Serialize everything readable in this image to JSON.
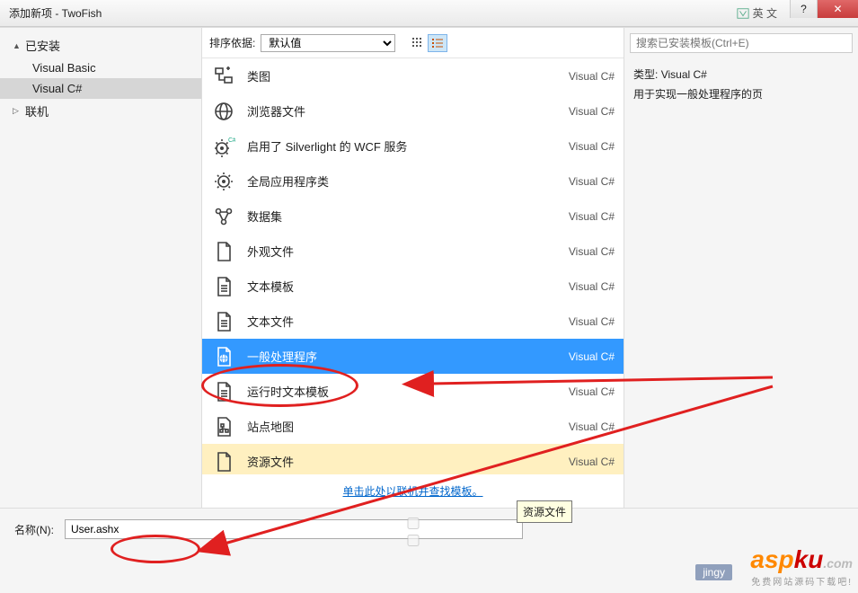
{
  "window": {
    "title": "添加新项 - TwoFish",
    "lang_indicator": "英 文"
  },
  "left": {
    "installed": "已安装",
    "items": [
      "Visual Basic",
      "Visual C#"
    ],
    "selected": "Visual C#",
    "online": "联机"
  },
  "toolbar": {
    "sort_label": "排序依据:",
    "sort_value": "默认值"
  },
  "templates": [
    {
      "name": "类图",
      "lang": "Visual C#",
      "icon": "class-diagram"
    },
    {
      "name": "浏览器文件",
      "lang": "Visual C#",
      "icon": "browser"
    },
    {
      "name": "启用了 Silverlight 的 WCF 服务",
      "lang": "Visual C#",
      "icon": "gear-cs"
    },
    {
      "name": "全局应用程序类",
      "lang": "Visual C#",
      "icon": "gear"
    },
    {
      "name": "数据集",
      "lang": "Visual C#",
      "icon": "dataset"
    },
    {
      "name": "外观文件",
      "lang": "Visual C#",
      "icon": "file"
    },
    {
      "name": "文本模板",
      "lang": "Visual C#",
      "icon": "text-file"
    },
    {
      "name": "文本文件",
      "lang": "Visual C#",
      "icon": "text-file"
    },
    {
      "name": "一般处理程序",
      "lang": "Visual C#",
      "icon": "globe-file",
      "state": "selected"
    },
    {
      "name": "运行时文本模板",
      "lang": "Visual C#",
      "icon": "text-file"
    },
    {
      "name": "站点地图",
      "lang": "Visual C#",
      "icon": "sitemap"
    },
    {
      "name": "资源文件",
      "lang": "Visual C#",
      "icon": "file",
      "state": "hovered"
    }
  ],
  "online_link": "单击此处以联机并查找模板。",
  "tooltip": "资源文件",
  "right": {
    "search_placeholder": "搜索已安装模板(Ctrl+E)",
    "type_label": "类型:",
    "type_value": "Visual C#",
    "description": "用于实现一般处理程序的页"
  },
  "bottom": {
    "name_label": "名称(N):",
    "name_value": "User.ashx"
  },
  "watermark": {
    "a": "asp",
    "b": "ku",
    "c": "免费网站源码下载吧!"
  },
  "jingyan": "jingy"
}
